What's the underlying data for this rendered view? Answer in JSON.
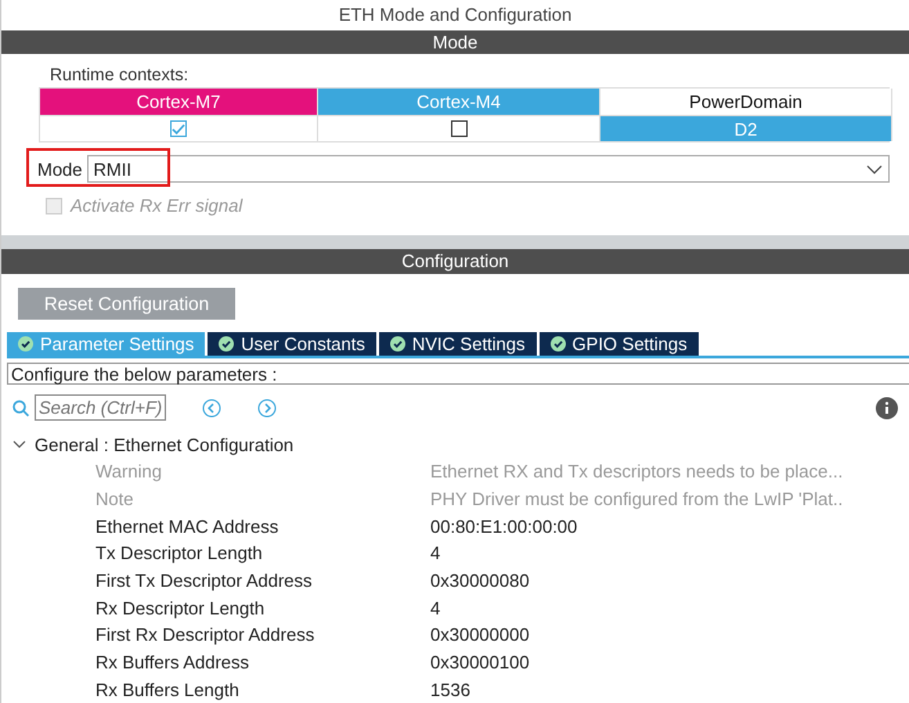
{
  "window": {
    "title": "ETH Mode and Configuration"
  },
  "mode_section": {
    "title": "Mode",
    "runtime_label": "Runtime contexts:",
    "contexts": [
      {
        "name": "Cortex-M7",
        "color": "#e4117c",
        "checked": true
      },
      {
        "name": "Cortex-M4",
        "color": "#3ba7dc",
        "checked": false
      }
    ],
    "power_domain": {
      "label": "PowerDomain",
      "value": "D2"
    },
    "mode": {
      "label": "Mode",
      "value": "RMII",
      "highlighted": true
    },
    "rx_err": {
      "label": "Activate Rx Err signal",
      "checked": false,
      "disabled": true
    }
  },
  "config_section": {
    "title": "Configuration",
    "reset_button": "Reset Configuration",
    "tabs": [
      {
        "label": "Parameter Settings",
        "selected": true
      },
      {
        "label": "User Constants",
        "selected": false
      },
      {
        "label": "NVIC Settings",
        "selected": false
      },
      {
        "label": "GPIO Settings",
        "selected": false
      }
    ],
    "hint": "Configure the below parameters :",
    "search": {
      "placeholder": "Search (Ctrl+F)"
    },
    "tree": {
      "label": "General : Ethernet Configuration",
      "expanded": true,
      "children": [
        {
          "name": "Warning",
          "value": "Ethernet RX and Tx descriptors needs to be place...",
          "disabled": true
        },
        {
          "name": "Note",
          "value": "PHY Driver must be configured from the LwIP 'Plat..",
          "disabled": true
        },
        {
          "name": "Ethernet MAC Address",
          "value": "00:80:E1:00:00:00",
          "disabled": false
        },
        {
          "name": "Tx Descriptor Length",
          "value": "4",
          "disabled": false
        },
        {
          "name": "First Tx Descriptor Address",
          "value": "0x30000080",
          "disabled": false
        },
        {
          "name": "Rx Descriptor Length",
          "value": "4",
          "disabled": false
        },
        {
          "name": "First Rx Descriptor Address",
          "value": "0x30000000",
          "disabled": false
        },
        {
          "name": "Rx Buffers Address",
          "value": "0x30000100",
          "disabled": false
        },
        {
          "name": "Rx Buffers Length",
          "value": "1536",
          "disabled": false
        }
      ]
    }
  }
}
